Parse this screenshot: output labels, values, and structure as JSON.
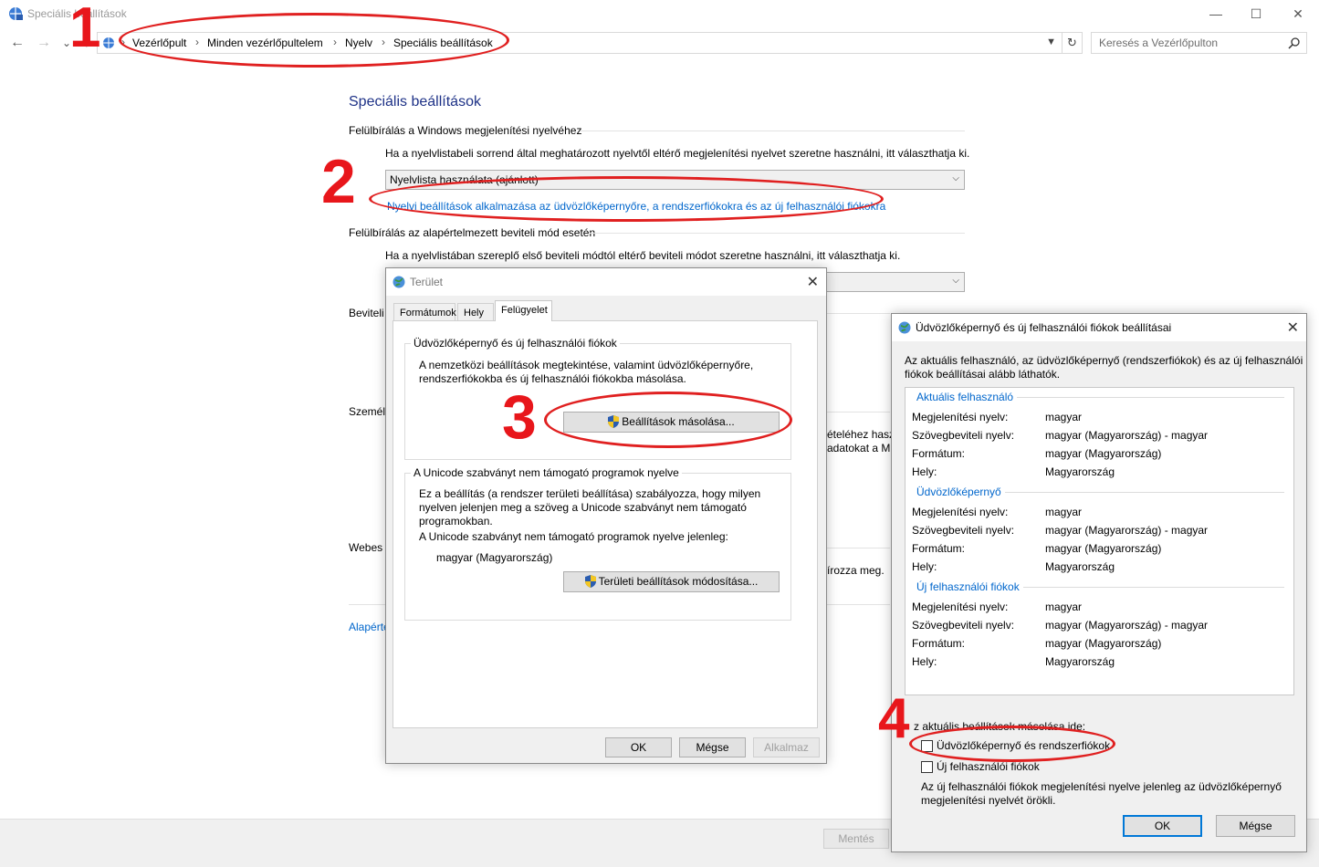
{
  "window": {
    "title": "Speciális beállítások",
    "controls": [
      "—",
      "☐",
      "✕"
    ]
  },
  "nav": {
    "back": "←",
    "forward": "→",
    "recent": "⌄",
    "up": "↑",
    "breadcrumbs": [
      "Vezérlőpult",
      "Minden vezérlőpultelem",
      "Nyelv",
      "Speciális beállítások"
    ],
    "separator": "›",
    "search_placeholder": "Keresés a Vezérlőpulton"
  },
  "main": {
    "title": "Speciális beállítások",
    "section1_header": "Felülbírálás a Windows megjelenítési nyelvéhez",
    "section1_text": "Ha a nyelvlistabeli sorrend által meghatározott nyelvtől eltérő megjelenítési nyelvet szeretne használni, itt választhatja ki.",
    "section1_select": "Nyelvlista használata (ajánlott)",
    "section1_link": "Nyelvi beállítások alkalmazása az üdvözlőképernyőre, a rendszerfiókokra és az új felhasználói fiókokra",
    "section2_header": "Felülbírálás az alapértelmezett beviteli mód esetén",
    "section2_text": "Ha a nyelvlistában szereplő első beviteli módtól eltérő beviteli módot szeretne használni, itt választhatja ki.",
    "stub_beviteli": "Beviteli",
    "stub_szemely": "Személy",
    "stub_webes": "Webes t",
    "stub_alap": "Alapérte",
    "stub_r1": "ételéhez haszn",
    "stub_r2": "adatokat a M",
    "stub_r3": "írozza meg.",
    "save_label": "Mentés"
  },
  "region_dialog": {
    "title": "Terület",
    "tabs": [
      "Formátumok",
      "Hely",
      "Felügyelet"
    ],
    "group1_title": "Üdvözlőképernyő és új felhasználói fiókok",
    "group1_text1": "A nemzetközi beállítások megtekintése, valamint üdvözlőképernyőre,",
    "group1_text2": "rendszerfiókokba és új felhasználói fiókokba másolása.",
    "copy_button": "Beállítások másolása...",
    "group2_title": "A Unicode szabványt nem támogató programok nyelve",
    "group2_text1": "Ez a beállítás (a rendszer területi beállítása) szabályozza, hogy milyen",
    "group2_text2": "nyelven jelenjen meg a szöveg a Unicode szabványt nem támogató",
    "group2_text3": "programokban.",
    "group2_text4": "A Unicode szabványt nem támogató programok nyelve jelenleg:",
    "current_locale": "magyar (Magyarország)",
    "change_button": "Területi beállítások módosítása...",
    "ok": "OK",
    "cancel": "Mégse",
    "apply": "Alkalmaz"
  },
  "welcome_dialog": {
    "title": "Üdvözlőképernyő és új felhasználói fiókok beállításai",
    "intro1": "Az aktuális felhasználó, az üdvözlőképernyő (rendszerfiókok) és az új felhasználói",
    "intro2": "fiókok beállításai alább láthatók.",
    "sections": [
      {
        "heading": "Aktuális felhasználó",
        "rows": [
          {
            "label": "Megjelenítési nyelv:",
            "value": "magyar"
          },
          {
            "label": "Szövegbeviteli nyelv:",
            "value": "magyar (Magyarország) - magyar"
          },
          {
            "label": "Formátum:",
            "value": "magyar (Magyarország)"
          },
          {
            "label": "Hely:",
            "value": "Magyarország"
          }
        ]
      },
      {
        "heading": "Üdvözlőképernyő",
        "rows": [
          {
            "label": "Megjelenítési nyelv:",
            "value": "magyar"
          },
          {
            "label": "Szövegbeviteli nyelv:",
            "value": "magyar (Magyarország) - magyar"
          },
          {
            "label": "Formátum:",
            "value": "magyar (Magyarország)"
          },
          {
            "label": "Hely:",
            "value": "Magyarország"
          }
        ]
      },
      {
        "heading": "Új felhasználói fiókok",
        "rows": [
          {
            "label": "Megjelenítési nyelv:",
            "value": "magyar"
          },
          {
            "label": "Szövegbeviteli nyelv:",
            "value": "magyar (Magyarország) - magyar"
          },
          {
            "label": "Formátum:",
            "value": "magyar (Magyarország)"
          },
          {
            "label": "Hely:",
            "value": "Magyarország"
          }
        ]
      }
    ],
    "copy_label": "z aktuális beállítások másolása ide:",
    "cb1_label": "Üdvözlőképernyő és rendszerfiókok",
    "cb2_label": "Új felhasználói fiókok",
    "note1": "Az új felhasználói fiókok megjelenítési nyelve jelenleg az üdvözlőképernyő",
    "note2": "megjelenítési nyelvét örökli.",
    "ok": "OK",
    "cancel": "Mégse"
  },
  "annotations": {
    "n1": "1",
    "n2": "2",
    "n3": "3",
    "n4": "4",
    "color": "#e8161b"
  }
}
